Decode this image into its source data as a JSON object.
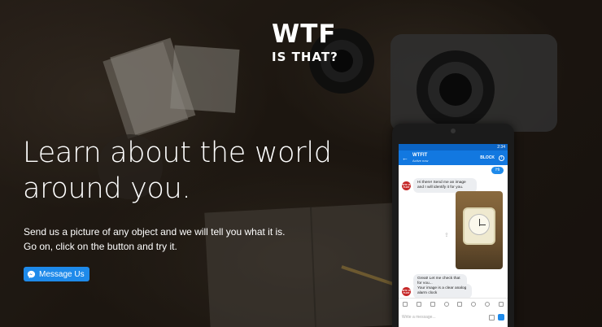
{
  "logo": {
    "main": "WTF",
    "sub": "IS THAT?"
  },
  "hero": {
    "headline_line1": "Learn about the world",
    "headline_line2": "around you.",
    "desc_line1": "Send us a picture of any object and we will tell you what it is.",
    "desc_line2": "Go on, click on the button and try it."
  },
  "cta": {
    "label": "Message Us",
    "icon": "messenger-icon"
  },
  "phone": {
    "status_time": "2:34",
    "chat_title": "WTFIT",
    "chat_subtitle": "Active now",
    "block_label": "BLOCK",
    "avatar_text": "WTF IS THAT",
    "messages": {
      "me_hi": "Hi",
      "bot_greeting": "Hi there! Send me an image and I will identify it for you.",
      "bot_check": "Great! Let me check that for you...",
      "bot_result": "Your image is a clear analog alarm clock"
    },
    "composer_placeholder": "Write a message..."
  },
  "colors": {
    "accent": "#1e8aea",
    "appbar": "#1278e0"
  }
}
